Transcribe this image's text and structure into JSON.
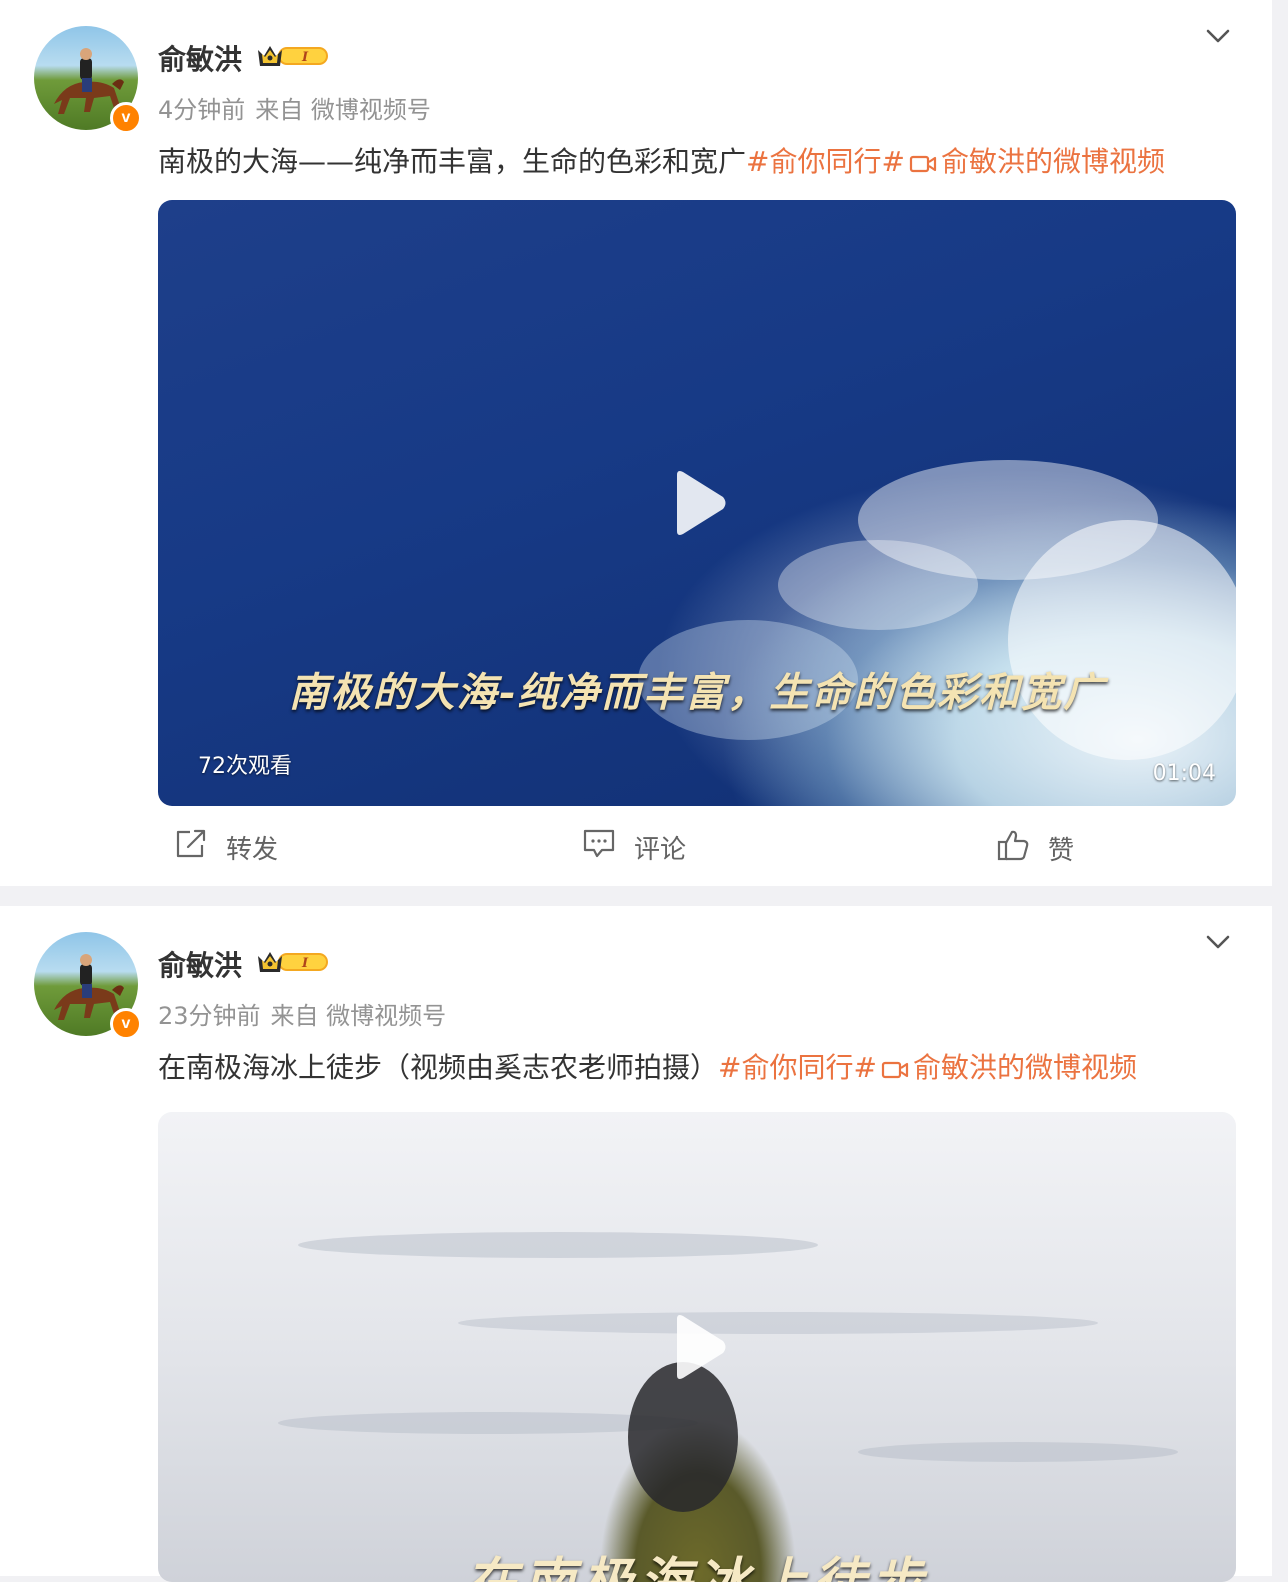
{
  "posts": [
    {
      "author": "俞敏洪",
      "time": "4分钟前",
      "source": "来自 微博视频号",
      "text": "南极的大海——纯净而丰富，生命的色彩和宽广",
      "hashtag": "#俞你同行#",
      "video_link_label": "俞敏洪的微博视频",
      "video": {
        "subtitle": "南极的大海-纯净而丰富，生命的色彩和宽广",
        "views": "72次观看",
        "duration": "01:04"
      },
      "actions": {
        "repost": "转发",
        "comment": "评论",
        "like": "赞"
      }
    },
    {
      "author": "俞敏洪",
      "time": "23分钟前",
      "source": "来自 微博视频号",
      "text": "在南极海冰上徒步（视频由奚志农老师拍摄）",
      "hashtag": "#俞你同行#",
      "video_link_label": "俞敏洪的微博视频",
      "video": {
        "subtitle": "在南极海冰上徒步"
      }
    }
  ],
  "colors": {
    "accent": "#eb7340",
    "verified": "#ff8200",
    "muted": "#939393"
  },
  "icons": {
    "verified": "verified-v-icon",
    "vip": "vip-crown-badge-icon",
    "menu": "chevron-down-icon",
    "video_link": "video-camera-icon",
    "play": "play-icon",
    "repost": "repost-icon",
    "comment": "comment-icon",
    "like": "thumbs-up-icon"
  }
}
